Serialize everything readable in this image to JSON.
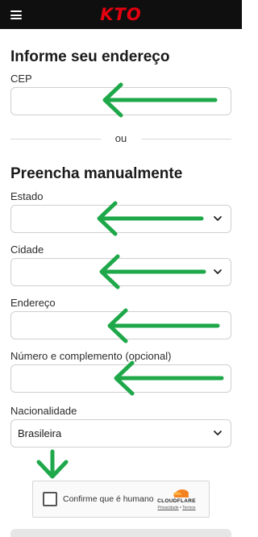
{
  "header": {
    "logo": "KTO",
    "menu_icon": "hamburger-menu-icon"
  },
  "address_section": {
    "title": "Informe seu endereço",
    "cep_label": "CEP",
    "cep_value": "",
    "cep_placeholder": ""
  },
  "divider_text": "ou",
  "manual_section": {
    "title": "Preencha manualmente",
    "state_label": "Estado",
    "state_value": "",
    "city_label": "Cidade",
    "city_value": "",
    "address_label": "Endereço",
    "address_value": "",
    "number_label": "Número e complemento (opcional)",
    "number_value": "",
    "nationality_label": "Nacionalidade",
    "nationality_value": "Brasileira"
  },
  "captcha": {
    "label": "Confirme que é humano",
    "brand": "CLOUDFLARE",
    "privacy": "Privacidade",
    "separator": " • ",
    "terms": "Termos"
  },
  "colors": {
    "brand": "#e4000f",
    "arrow": "#1ea84a",
    "header_bg": "#0f0f0f"
  }
}
